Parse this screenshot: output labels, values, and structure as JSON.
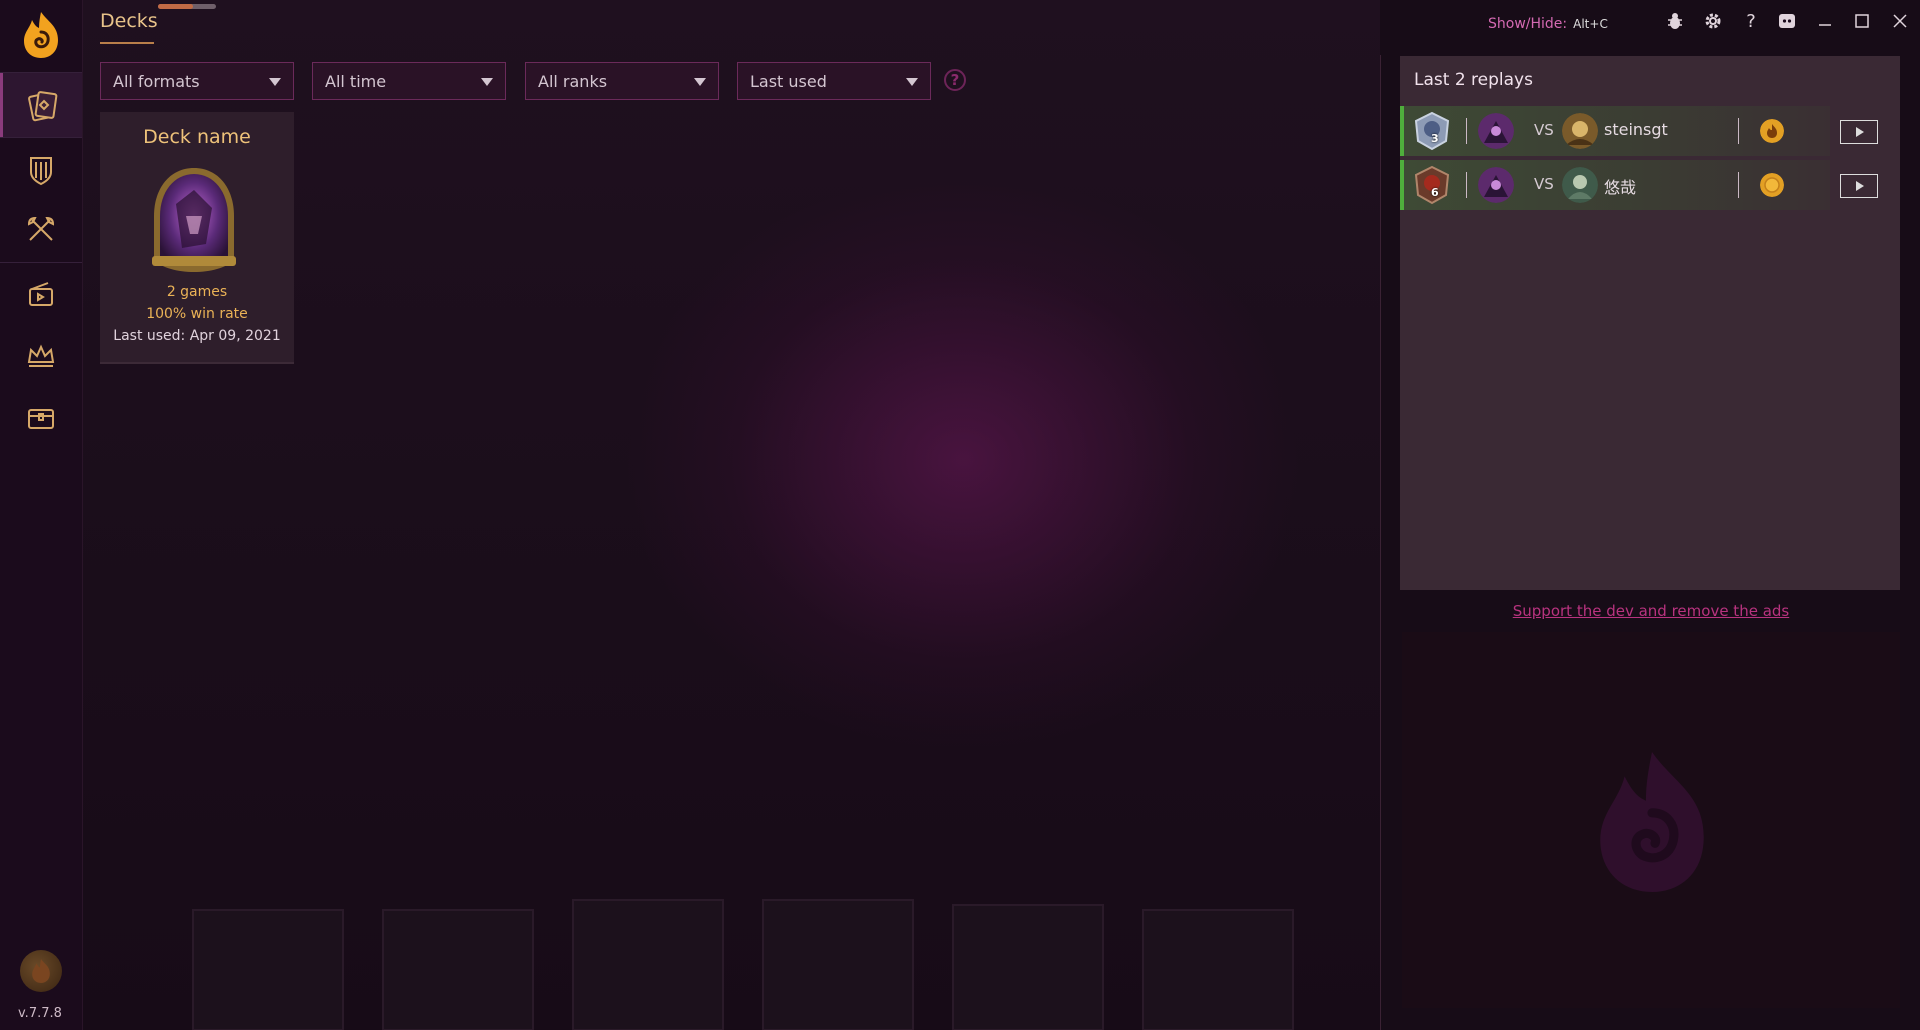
{
  "app": {
    "page_title": "Decks",
    "version": "v.7.7.8",
    "showhide_label": "Show/Hide:",
    "showhide_key": "Alt+C",
    "header_progress_pct": 60
  },
  "sidebar": {
    "items": [
      {
        "name": "decks",
        "icon": "cards-icon",
        "active": true
      },
      {
        "name": "arena",
        "icon": "shield-icon",
        "active": false
      },
      {
        "name": "battlegrounds",
        "icon": "crossed-axes-icon",
        "active": false
      },
      {
        "name": "replays",
        "icon": "replay-cards-icon",
        "active": false
      },
      {
        "name": "ranked",
        "icon": "crown-icon",
        "active": false
      },
      {
        "name": "collection",
        "icon": "chest-icon",
        "active": false
      }
    ]
  },
  "filters": {
    "format": "All formats",
    "time": "All time",
    "rank": "All ranks",
    "sort": "Last used",
    "help": "?"
  },
  "deck": {
    "name": "Deck name",
    "games": "2 games",
    "winrate": "100% win rate",
    "last_used": "Last used: Apr 09, 2021"
  },
  "replays": {
    "title": "Last 2 replays",
    "vs_label": "VS",
    "rows": [
      {
        "rank": "3",
        "opponent": "steinsgt",
        "result_icon": "coin-flame-icon"
      },
      {
        "rank": "6",
        "opponent": "悠哉",
        "result_icon": "coin-icon"
      }
    ]
  },
  "support": {
    "link_text": "Support the dev and remove the ads"
  },
  "colors": {
    "accent_gold": "#eec27a",
    "accent_pink": "#b8337f",
    "win_green": "#4fae3c"
  }
}
